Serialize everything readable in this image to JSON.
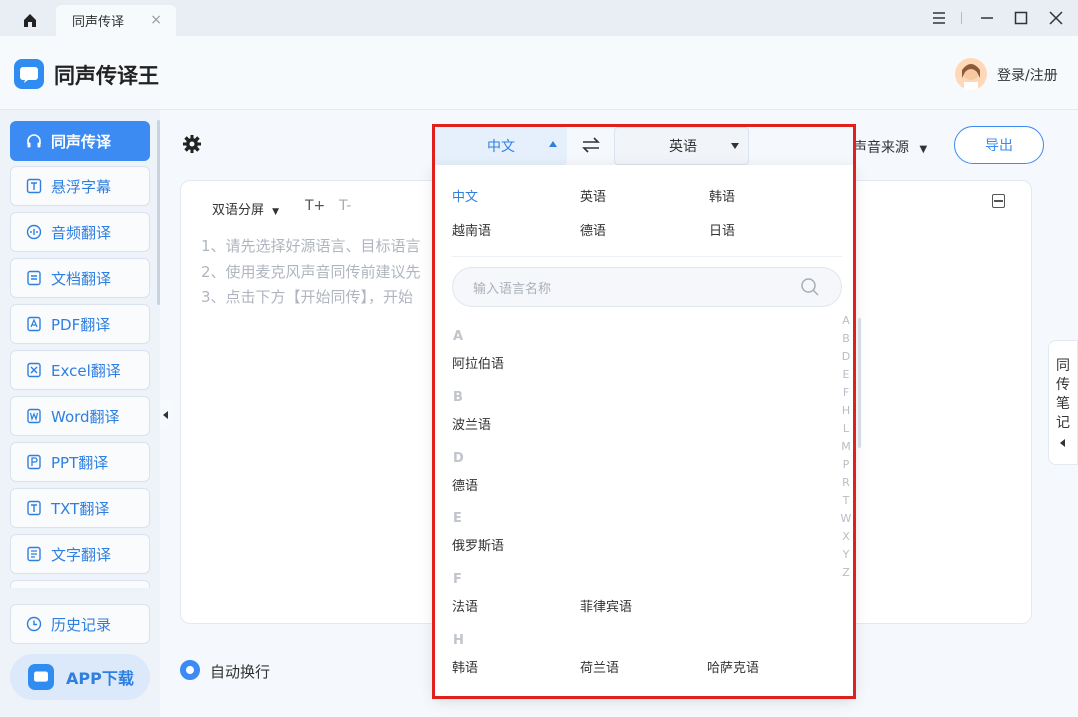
{
  "tab": {
    "title": "同声传译"
  },
  "app": {
    "title": "同声传译王",
    "login": "登录/注册"
  },
  "sidebar": {
    "items": [
      {
        "label": "同声传译",
        "icon": "headphones-icon"
      },
      {
        "label": "悬浮字幕",
        "icon": "subtitle-icon"
      },
      {
        "label": "音频翻译",
        "icon": "audio-icon"
      },
      {
        "label": "文档翻译",
        "icon": "document-icon"
      },
      {
        "label": "PDF翻译",
        "icon": "pdf-icon"
      },
      {
        "label": "Excel翻译",
        "icon": "excel-icon"
      },
      {
        "label": "Word翻译",
        "icon": "word-icon"
      },
      {
        "label": "PPT翻译",
        "icon": "ppt-icon"
      },
      {
        "label": "TXT翻译",
        "icon": "txt-icon"
      },
      {
        "label": "文字翻译",
        "icon": "text-translate-icon"
      }
    ],
    "history": "历史记录",
    "app_download": "APP下载"
  },
  "toolbar": {
    "source_language": "中文",
    "target_language": "英语",
    "audio_source": "声音来源",
    "export": "导出"
  },
  "panel": {
    "split_mode": "双语分屏",
    "font_plus": "T+",
    "font_minus": "T-",
    "hints": [
      "1、请先选择好源语言、目标语言",
      "2、使用麦克风声音同传前建议先",
      "3、点击下方【开始同传】，开始"
    ]
  },
  "auto_wrap": "自动换行",
  "notes_tab": [
    "同",
    "传",
    "笔",
    "记"
  ],
  "dropdown": {
    "common": [
      "中文",
      "英语",
      "韩语",
      "越南语",
      "德语",
      "日语"
    ],
    "search_placeholder": "输入语言名称",
    "groups": [
      {
        "letter": "A",
        "languages": [
          "阿拉伯语"
        ]
      },
      {
        "letter": "B",
        "languages": [
          "波兰语"
        ]
      },
      {
        "letter": "D",
        "languages": [
          "德语"
        ]
      },
      {
        "letter": "E",
        "languages": [
          "俄罗斯语"
        ]
      },
      {
        "letter": "F",
        "languages": [
          "法语",
          "菲律宾语"
        ]
      },
      {
        "letter": "H",
        "languages": [
          "韩语",
          "荷兰语",
          "哈萨克语"
        ]
      }
    ],
    "alphabet": [
      "A",
      "B",
      "D",
      "E",
      "F",
      "H",
      "L",
      "M",
      "P",
      "R",
      "T",
      "W",
      "X",
      "Y",
      "Z"
    ]
  },
  "colors": {
    "accent": "#3b8bf2",
    "highlight": "#e0201c"
  }
}
